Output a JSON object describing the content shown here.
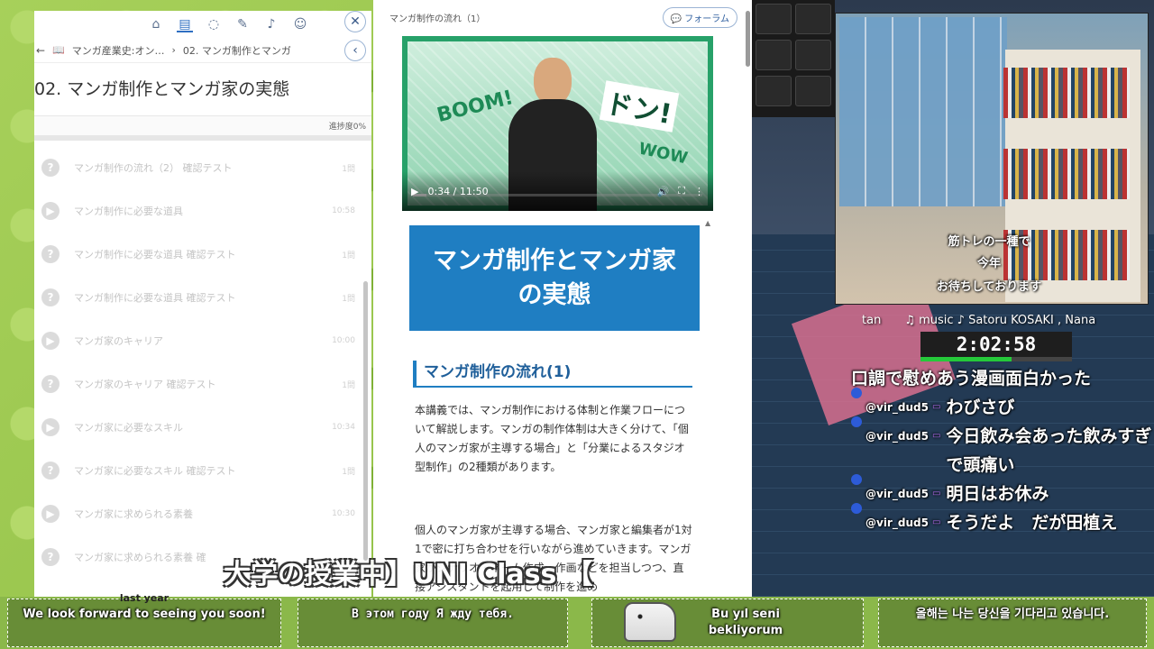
{
  "lms": {
    "back_label": "←",
    "breadcrumb_1": "マンガ産業史:オン…",
    "breadcrumb_2": "02. マンガ制作とマンガ",
    "title": "02. マンガ制作とマンガ家の実態",
    "progress_label": "進捗度0%",
    "progress_value": 0,
    "lessons": [
      {
        "icon": "?",
        "name": "マンガ制作の流れ（2） 確認テスト",
        "meta": "1問"
      },
      {
        "icon": "▶",
        "name": "マンガ制作に必要な道具",
        "meta": "10:58"
      },
      {
        "icon": "?",
        "name": "マンガ制作に必要な道具 確認テスト",
        "meta": "1問"
      },
      {
        "icon": "?",
        "name": "マンガ制作に必要な道具 確認テスト",
        "meta": "1問"
      },
      {
        "icon": "▶",
        "name": "マンガ家のキャリア",
        "meta": "10:00"
      },
      {
        "icon": "?",
        "name": "マンガ家のキャリア 確認テスト",
        "meta": "1問"
      },
      {
        "icon": "▶",
        "name": "マンガ家に必要なスキル",
        "meta": "10:34"
      },
      {
        "icon": "?",
        "name": "マンガ家に必要なスキル 確認テスト",
        "meta": "1問"
      },
      {
        "icon": "▶",
        "name": "マンガ家に求められる素養",
        "meta": "10:30"
      },
      {
        "icon": "?",
        "name": "マンガ家に求められる素養 確",
        "meta": ""
      }
    ]
  },
  "content": {
    "header_title": "マンガ制作の流れ（1）",
    "forum_label": "フォーラム",
    "video": {
      "time": "0:34 / 11:50",
      "played_fraction": 0.048,
      "boom": "BOOM!",
      "don": "ドン!",
      "wow": "WOW"
    },
    "banner": "マンガ制作とマンガ家の実態",
    "section": "マンガ制作の流れ(1)",
    "paragraph_1": "本講義では、マンガ制作における体制と作業フローについて解説します。マンガの制作体制は大きく分けて、「個人のマンガ家が主導する場合」と「分業によるスタジオ型制作」の2種類があります。",
    "paragraph_2": "個人のマンガ家が主導する場合、マンガ家と編集者が1対1で密に打ち合わせを行いながら進めていきます。マンガ家がシナリオ・ネーム作成、作画などを担当しつつ、直接アシスタントを起用して制作を進め"
  },
  "stream": {
    "room_captions": [
      "筋トレの一種で",
      "今年",
      "お待ちしております"
    ],
    "music": "tan　　♫ music ♪ Satoru KOSAKI , Nana",
    "timer": "2:02:58",
    "timer_fraction": 0.6,
    "chat": [
      {
        "user": "",
        "text": "口調で慰めあう漫画面白かった"
      },
      {
        "user": "@vir_dud5",
        "text": "わびさび"
      },
      {
        "user": "@vir_dud5",
        "text": "今日飲み会あった飲みすぎで頭痛い"
      },
      {
        "user": "@vir_dud5",
        "text": "明日はお休み"
      },
      {
        "user": "@vir_dud5",
        "text": "そうだよ　だが田植え"
      }
    ],
    "big_caption": "大学の授業中】UNI Class 【"
  },
  "subtitles": [
    {
      "faded": "last year",
      "text": "We look forward to seeing you soon!"
    },
    {
      "faded": "",
      "text": "В этом году Я жду тебя."
    },
    {
      "faded": "",
      "text": "Bu yıl seni bekliyorum"
    },
    {
      "faded": "",
      "text": "올해는 나는 당신을 기다리고 있습니다."
    }
  ]
}
